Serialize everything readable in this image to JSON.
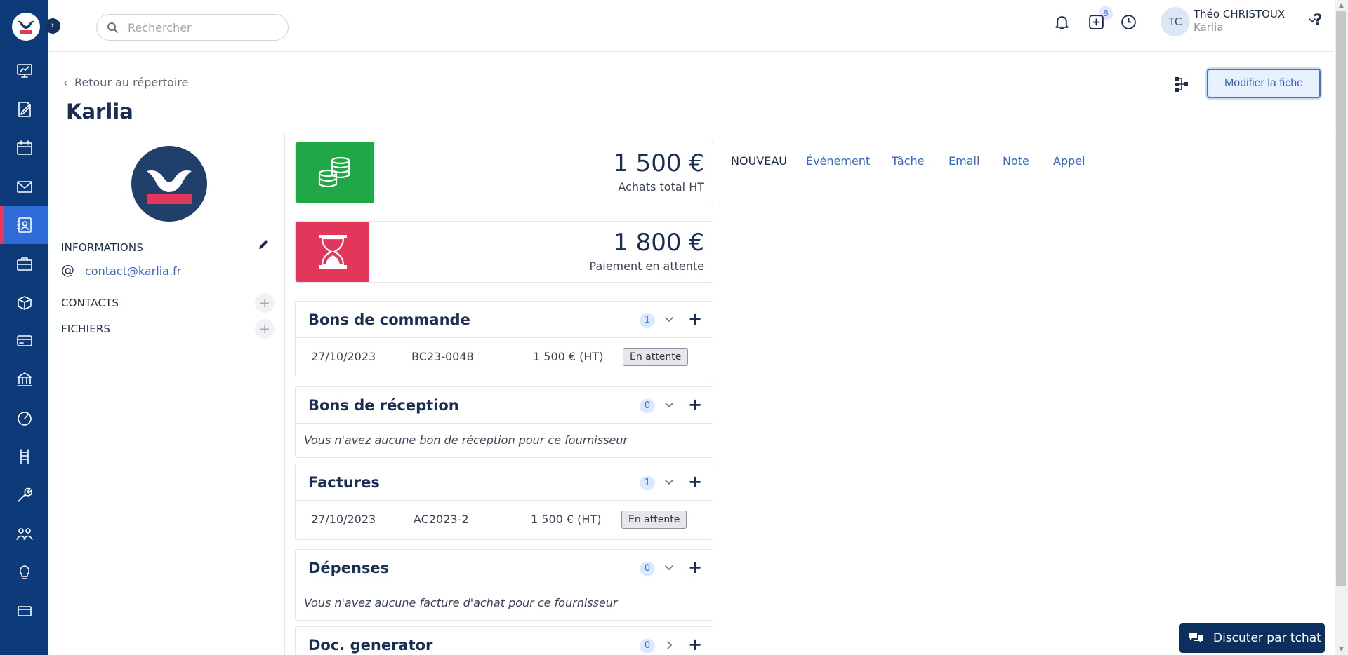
{
  "colors": {
    "sidebar": "#0d3a78",
    "sidebar_active": "#2f6ad9",
    "accent_red": "#e8375a",
    "link_blue": "#3568c8",
    "purchase_green": "#21a846",
    "pending_red": "#e2375b",
    "navy": "#1a2d52"
  },
  "sidebar": {
    "items": [
      {
        "icon": "dashboard-icon"
      },
      {
        "icon": "edit-document-icon"
      },
      {
        "icon": "calendar-icon"
      },
      {
        "icon": "mail-icon"
      },
      {
        "icon": "contacts-book-icon"
      },
      {
        "icon": "briefcase-icon"
      },
      {
        "icon": "box-icon"
      },
      {
        "icon": "credit-card-icon"
      },
      {
        "icon": "bank-icon"
      },
      {
        "icon": "gauge-icon"
      },
      {
        "icon": "ladder-icon"
      },
      {
        "icon": "wrench-icon"
      },
      {
        "icon": "team-icon"
      },
      {
        "icon": "lightbulb-icon"
      },
      {
        "icon": "card-icon"
      }
    ]
  },
  "header": {
    "search_placeholder": "Rechercher",
    "notifications_count": "8",
    "user_initials": "TC",
    "user_name": "Théo CHRISTOUX",
    "user_company": "Karlia",
    "help_label": "?"
  },
  "page": {
    "back_label": "Retour au répertoire",
    "title": "Karlia",
    "modify_label": "Modifier la fiche"
  },
  "left": {
    "informations_label": "INFORMATIONS",
    "email": "contact@karlia.fr",
    "at_symbol": "@",
    "contacts_label": "CONTACTS",
    "fichiers_label": "FICHIERS",
    "plus": "+"
  },
  "stats": {
    "purchases_amount": "1 500 €",
    "purchases_label": "Achats total HT",
    "pending_amount": "1 800 €",
    "pending_label": "Paiement en attente"
  },
  "sections": {
    "orders": {
      "title": "Bons de commande",
      "count": "1",
      "plus": "+",
      "row": {
        "date": "27/10/2023",
        "ref": "BC23-0048",
        "amount": "1 500 € (HT)",
        "status": "En attente"
      }
    },
    "receipts": {
      "title": "Bons de réception",
      "count": "0",
      "plus": "+",
      "empty": "Vous n'avez aucune bon de réception pour ce fournisseur"
    },
    "invoices": {
      "title": "Factures",
      "count": "1",
      "plus": "+",
      "row": {
        "date": "27/10/2023",
        "ref": "AC2023-2",
        "amount": "1 500 € (HT)",
        "status": "En attente"
      }
    },
    "expenses": {
      "title": "Dépenses",
      "count": "0",
      "plus": "+",
      "empty": "Vous n'avez aucune facture d'achat pour ce fournisseur"
    },
    "docgen": {
      "title": "Doc. generator",
      "count": "0",
      "plus": "+"
    }
  },
  "tabs": {
    "nouveau": "NOUVEAU",
    "event": "Événement",
    "task": "Tâche",
    "email": "Email",
    "note": "Note",
    "call": "Appel"
  },
  "chat": {
    "label": "Discuter par tchat"
  }
}
